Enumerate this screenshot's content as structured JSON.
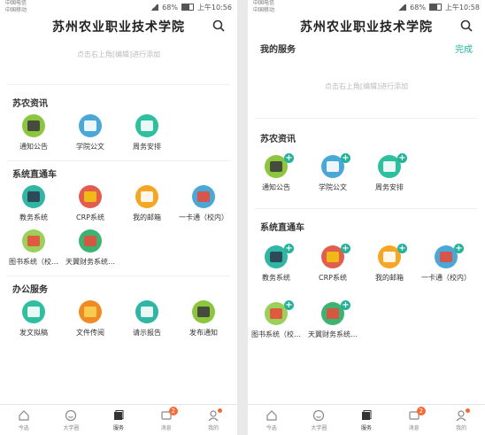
{
  "status_left": {
    "carrier1": "中国电信",
    "carrier2": "中国移动",
    "battery": "68%",
    "time": "上午10:56"
  },
  "status_right": {
    "carrier1": "中国电信",
    "carrier2": "中国移动",
    "battery": "68%",
    "time": "上午10:58"
  },
  "app_title": "苏州农业职业技术学院",
  "edit_hint": "点击右上角[编辑]进行添加",
  "my_services": "我的服务",
  "done": "完成",
  "sections": {
    "news": {
      "title": "苏农资讯",
      "items": [
        "通知公告",
        "学院公文",
        "周务安排"
      ]
    },
    "systems": {
      "title": "系统直通车",
      "items": [
        "教务系统",
        "CRP系统",
        "我的邮箱",
        "一卡通（校内）",
        "图书系统（校…",
        "天翼财务系统…"
      ]
    },
    "office": {
      "title": "办公服务",
      "items": [
        "发文拟稿",
        "文件传阅",
        "请示报告",
        "发布通知"
      ]
    }
  },
  "tabs": [
    "今选",
    "大学圈",
    "服务",
    "消息",
    "我的"
  ],
  "message_badge": "2",
  "colors": {
    "accent": "#23b39a",
    "badge": "#f56a35"
  }
}
